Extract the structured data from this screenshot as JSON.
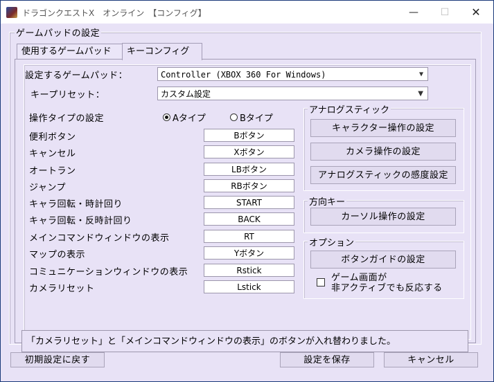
{
  "window": {
    "title": "ドラゴンクエストX　オンライン　【コンフィグ】",
    "minimize_glyph": "—",
    "maximize_glyph": "☐",
    "close_glyph": "✕"
  },
  "group": {
    "label": "ゲームパッドの設定"
  },
  "tabs": [
    {
      "label": "使用するゲームパッド",
      "selected": false
    },
    {
      "label": "キーコンフィグ",
      "selected": true
    }
  ],
  "gamepad": {
    "label": "設定するゲームパッド：",
    "value": "Controller (XBOX 360 For Windows)"
  },
  "preset": {
    "label": "キープリセット：",
    "value": "カスタム設定"
  },
  "operation_type": {
    "label": "操作タイプの設定",
    "options": [
      {
        "label": "Aタイプ",
        "selected": true
      },
      {
        "label": "Bタイプ",
        "selected": false
      }
    ]
  },
  "key_rows": [
    {
      "label": "便利ボタン",
      "value": "Bボタン"
    },
    {
      "label": "キャンセル",
      "value": "Xボタン"
    },
    {
      "label": "オートラン",
      "value": "LBボタン"
    },
    {
      "label": "ジャンプ",
      "value": "RBボタン"
    },
    {
      "label": "キャラ回転・時計回り",
      "value": "START"
    },
    {
      "label": "キャラ回転・反時計回り",
      "value": "BACK"
    },
    {
      "label": "メインコマンドウィンドウの表示",
      "value": "RT"
    },
    {
      "label": "マップの表示",
      "value": "Yボタン"
    },
    {
      "label": "コミュニケーションウィンドウの表示",
      "value": "Rstick"
    },
    {
      "label": "カメラリセット",
      "value": "Lstick"
    }
  ],
  "analog": {
    "label": "アナログスティック",
    "buttons": [
      "キャラクター操作の設定",
      "カメラ操作の設定",
      "アナログスティックの感度設定"
    ]
  },
  "direction": {
    "label": "方向キー",
    "button": "カーソル操作の設定"
  },
  "options": {
    "label": "オプション",
    "button": "ボタンガイドの設定",
    "checkbox_line1": "ゲーム画面が",
    "checkbox_line2": "非アクティブでも反応する",
    "checked": false
  },
  "message": "「カメラリセット」と「メインコマンドウィンドウの表示」のボタンが入れ替わりました。",
  "footer": {
    "reset": "初期設定に戻す",
    "save": "設定を保存",
    "cancel": "キャンセル"
  },
  "colors": {
    "background": "#e8e2f6",
    "titlebar": "#ffffff",
    "desktop": "#0a2a6b"
  }
}
